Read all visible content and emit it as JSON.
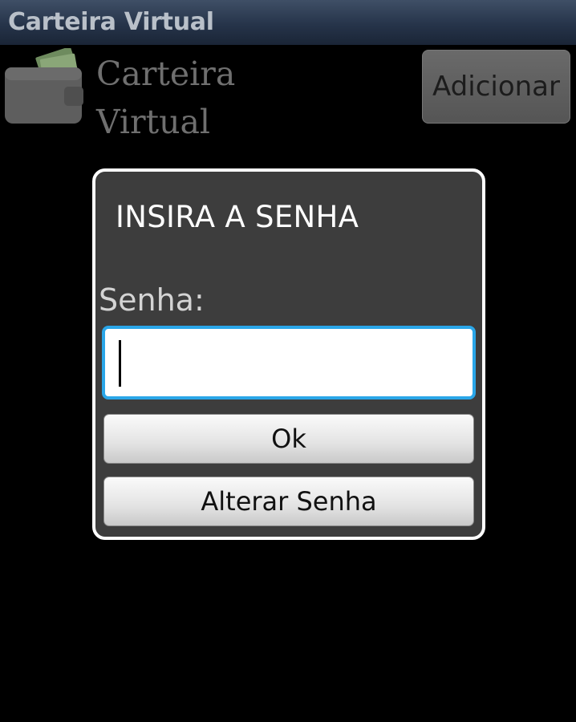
{
  "titlebar": {
    "title": "Carteira Virtual"
  },
  "header": {
    "app_name_line1": "Carteira",
    "app_name_line2": "Virtual",
    "add_button_label": "Adicionar",
    "icon": "wallet-icon"
  },
  "dialog": {
    "title": "INSIRA A SENHA",
    "password_label": "Senha:",
    "password_value": "",
    "ok_label": "Ok",
    "change_password_label": "Alterar Senha"
  },
  "colors": {
    "input_focus_border": "#2aa6e8",
    "dialog_background": "#3d3d3d",
    "titlebar": "#26344a"
  }
}
